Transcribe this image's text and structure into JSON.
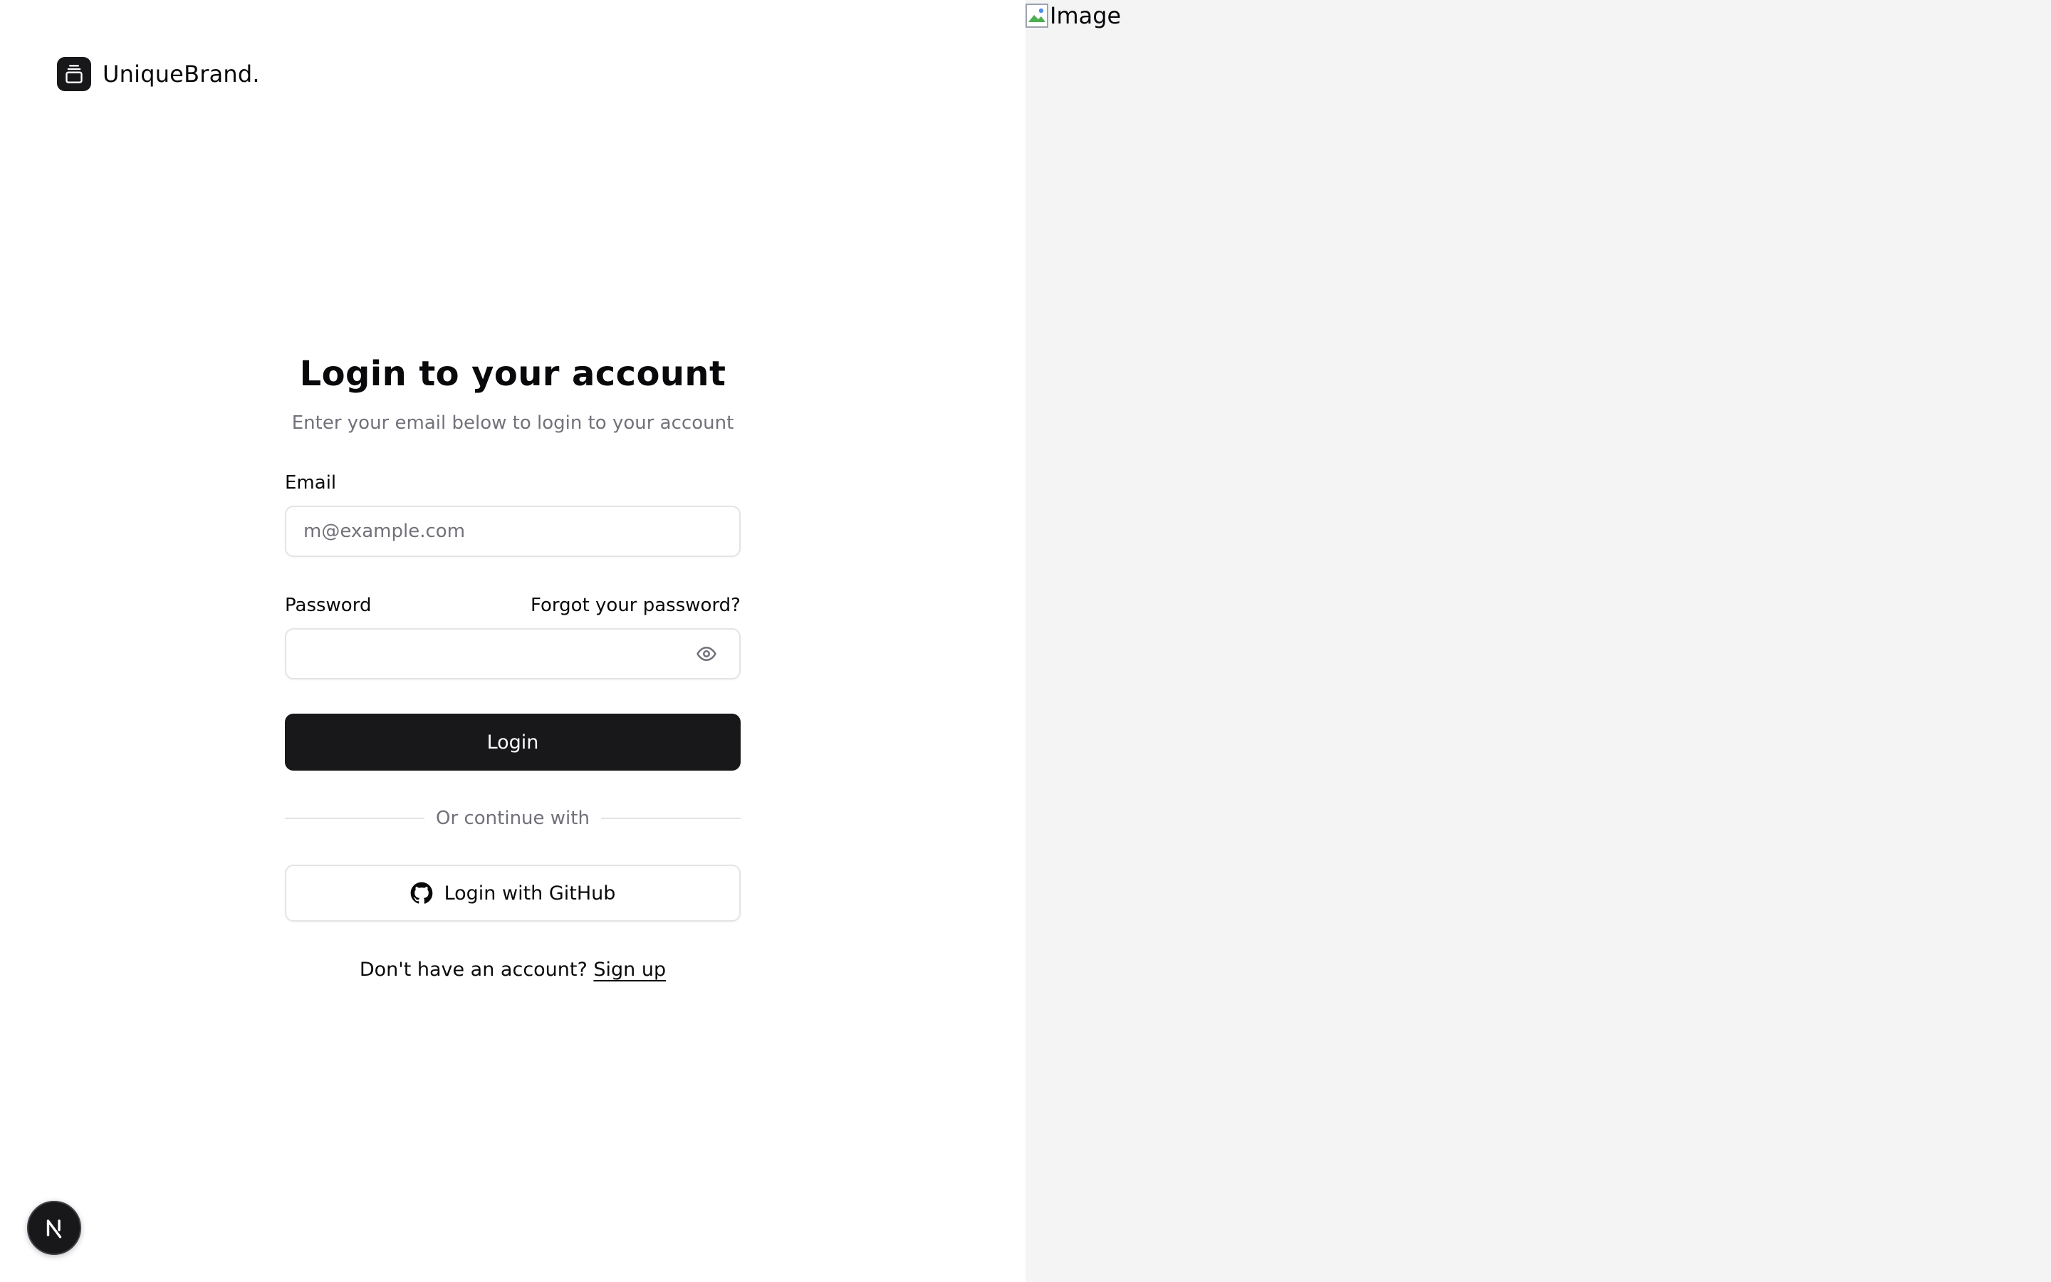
{
  "brand": {
    "name": "UniqueBrand."
  },
  "form": {
    "title": "Login to your account",
    "subtitle": "Enter your email below to login to your account",
    "email_label": "Email",
    "email_placeholder": "m@example.com",
    "email_value": "",
    "password_label": "Password",
    "forgot_link": "Forgot your password?",
    "password_value": "",
    "login_button": "Login",
    "divider_text": "Or continue with",
    "github_button": "Login with GitHub",
    "signup_prompt": "Don't have an account? ",
    "signup_link": "Sign up"
  },
  "devtools": {
    "badge_letter": "N"
  },
  "hero": {
    "image_alt": "Image"
  },
  "colors": {
    "primary": "#18181b",
    "muted_text": "#71717a",
    "border": "#e4e4e7",
    "right_panel_bg": "#f4f4f5"
  },
  "icons": {
    "brand": "gallery-vertical-end-icon",
    "password_toggle": "eye-icon",
    "github": "github-icon",
    "devtools": "nextjs-icon",
    "broken_image": "broken-image-icon"
  }
}
